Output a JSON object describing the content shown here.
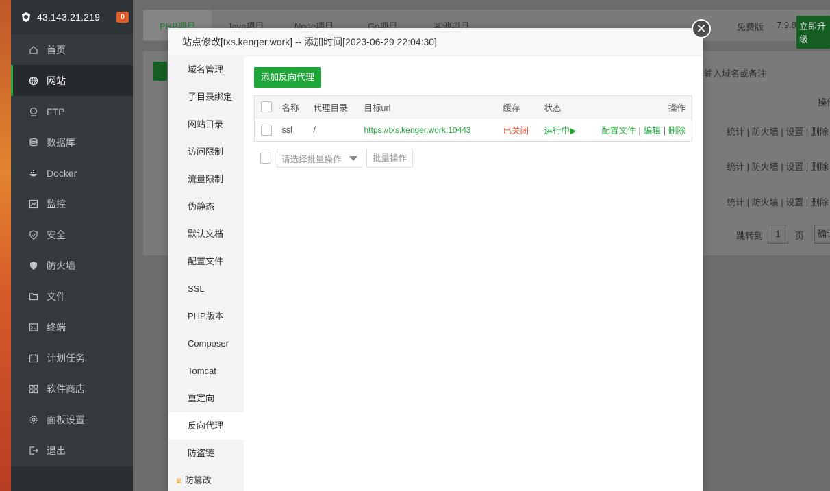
{
  "sidebar": {
    "ip": "43.143.21.219",
    "badge": "0",
    "items": [
      {
        "label": "首页",
        "icon": "home-icon"
      },
      {
        "label": "网站",
        "icon": "globe-icon"
      },
      {
        "label": "FTP",
        "icon": "ftp-icon"
      },
      {
        "label": "数据库",
        "icon": "database-icon"
      },
      {
        "label": "Docker",
        "icon": "docker-icon"
      },
      {
        "label": "监控",
        "icon": "monitor-icon"
      },
      {
        "label": "安全",
        "icon": "shield-icon"
      },
      {
        "label": "防火墙",
        "icon": "firewall-icon"
      },
      {
        "label": "文件",
        "icon": "folder-icon"
      },
      {
        "label": "终端",
        "icon": "terminal-icon"
      },
      {
        "label": "计划任务",
        "icon": "calendar-icon"
      },
      {
        "label": "软件商店",
        "icon": "grid-icon"
      },
      {
        "label": "面板设置",
        "icon": "gear-icon"
      },
      {
        "label": "退出",
        "icon": "logout-icon"
      }
    ]
  },
  "background": {
    "tabs": [
      "PHP项目",
      "Java项目",
      "Node项目",
      "Go项目",
      "其他项目"
    ],
    "edition": "免费版",
    "version": "7.9.8",
    "upgrade": "立即升级",
    "search_placeholder": "输入域名或备注",
    "ops_header": "操作",
    "row_actions": [
      "统计",
      "防火墙",
      "设置",
      "删除"
    ],
    "jump_label": "跳转到",
    "page_input": "1",
    "page_unit": "页",
    "confirm": "确认"
  },
  "modal": {
    "title": "站点修改[txs.kenger.work] -- 添加时间[2023-06-29 22:04:30]",
    "nav": [
      "域名管理",
      "子目录绑定",
      "网站目录",
      "访问限制",
      "流量限制",
      "伪静态",
      "默认文档",
      "配置文件",
      "SSL",
      "PHP版本",
      "Composer",
      "Tomcat",
      "重定向",
      "反向代理",
      "防盗链",
      "防篡改"
    ],
    "active_nav": "反向代理",
    "add_button": "添加反向代理",
    "table": {
      "headers": [
        "名称",
        "代理目录",
        "目标url",
        "缓存",
        "状态",
        "操作"
      ],
      "rows": [
        {
          "name": "ssl",
          "dir": "/",
          "url": "https://txs.kenger.work:10443",
          "cache": "已关闭",
          "status": "运行中▶",
          "actions": [
            "配置文件",
            "编辑",
            "删除"
          ]
        }
      ]
    },
    "batch_placeholder": "请选择批量操作",
    "batch_button": "批量操作"
  }
}
